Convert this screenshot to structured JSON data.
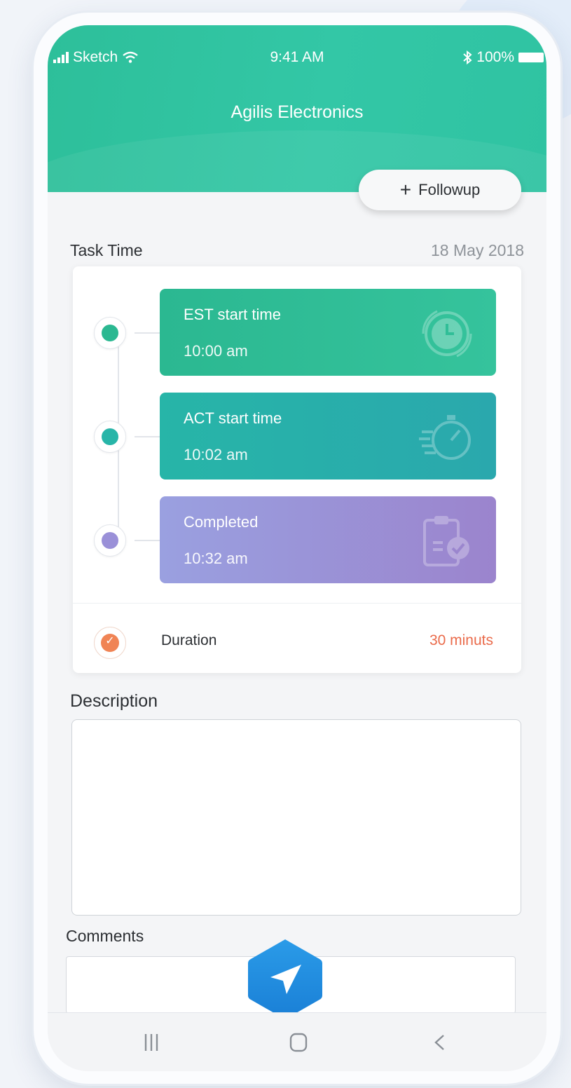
{
  "status_bar": {
    "carrier": "Sketch",
    "time": "9:41 AM",
    "battery": "100%"
  },
  "header": {
    "title": "Agilis Electronics",
    "followup_label": "Followup"
  },
  "task_time": {
    "label": "Task Time",
    "date": "18 May 2018",
    "items": [
      {
        "label": "EST start time",
        "time": "10:00 am",
        "icon": "clock-icon",
        "color": "#2bb891"
      },
      {
        "label": "ACT start time",
        "time": "10:02 am",
        "icon": "stopwatch-icon",
        "color": "#27b5a8"
      },
      {
        "label": "Completed",
        "time": "10:32 am",
        "icon": "clipboard-check-icon",
        "color": "#9a90d8"
      }
    ],
    "duration_label": "Duration",
    "duration_value": "30 minuts"
  },
  "description": {
    "label": "Description",
    "value": ""
  },
  "comments": {
    "label": "Comments",
    "value": ""
  },
  "nav": {
    "items": [
      "recent-apps-icon",
      "home-icon",
      "back-icon"
    ]
  },
  "colors": {
    "accent": "#2dbf9a",
    "duration": "#ea6b4b",
    "send_button": "#1e8ee3"
  }
}
